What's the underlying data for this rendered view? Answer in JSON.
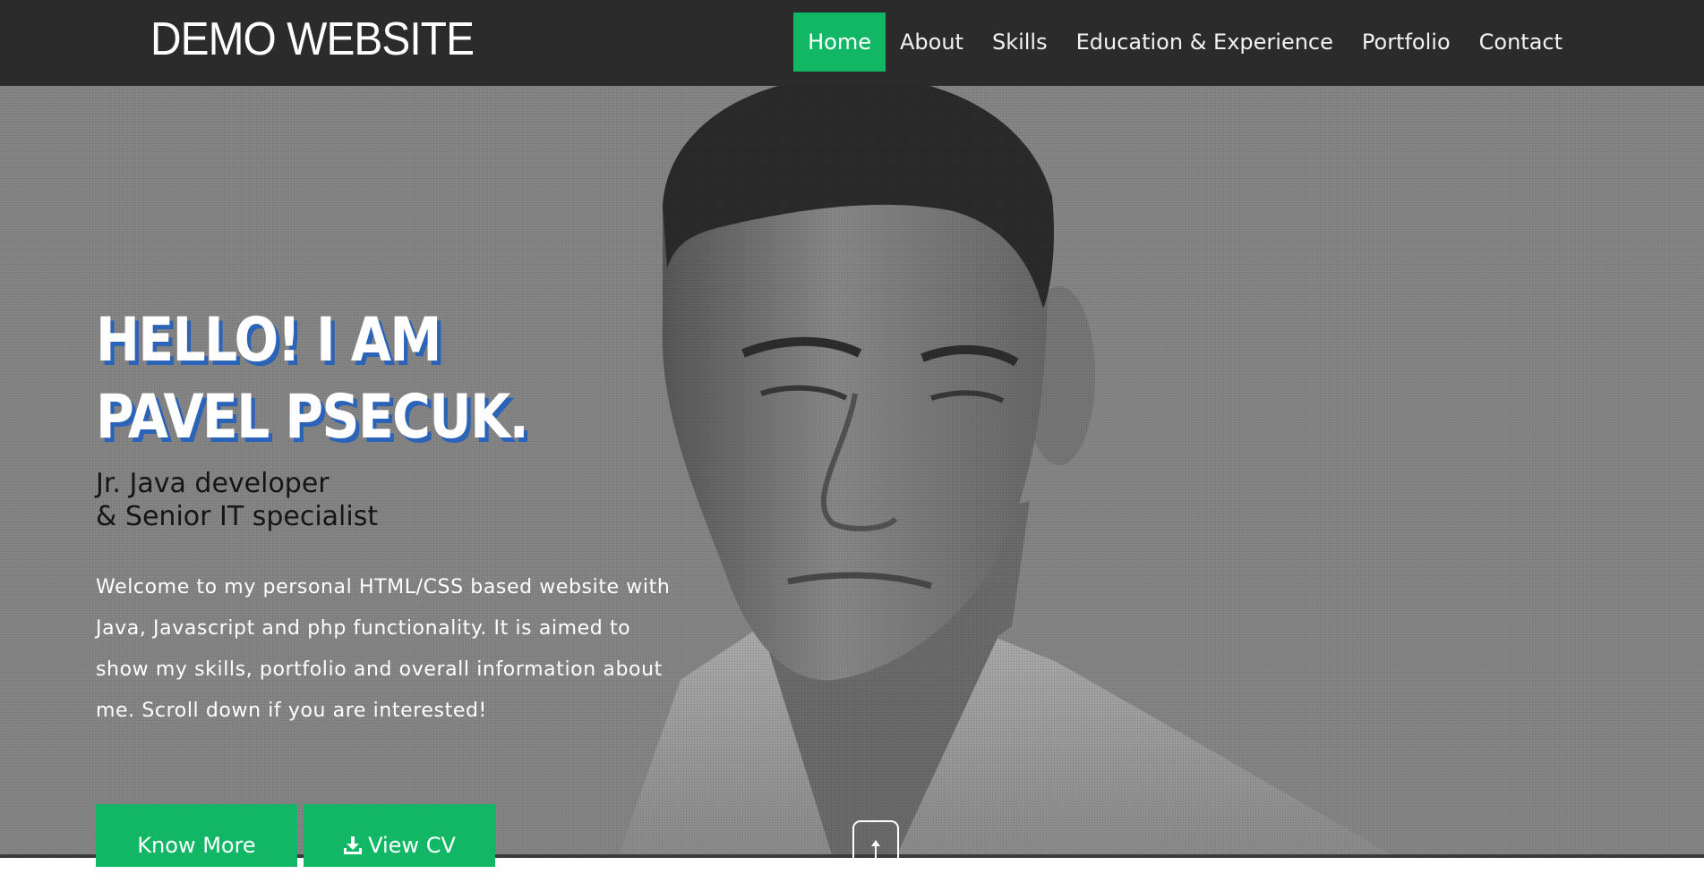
{
  "header": {
    "brand": "DEMO WEBSITE",
    "nav": [
      {
        "label": "Home",
        "active": true
      },
      {
        "label": "About",
        "active": false
      },
      {
        "label": "Skills",
        "active": false
      },
      {
        "label": "Education & Experience",
        "active": false
      },
      {
        "label": "Portfolio",
        "active": false
      },
      {
        "label": "Contact",
        "active": false
      }
    ]
  },
  "hero": {
    "headline_line1": "HELLO! I AM",
    "headline_line2": "PAVEL PSECUK.",
    "role_line1": "Jr. Java developer",
    "role_line2": "& Senior IT specialist",
    "intro": "Welcome to my personal HTML/CSS based website with Java, Javascript and php functionality. It is aimed to show my skills, portfolio and overall information about me. Scroll down if you are interested!",
    "buttons": {
      "know_more": "Know More",
      "view_cv": "View CV",
      "view_cv_icon": "download-icon"
    },
    "scroll_icon": "scroll-up-icon"
  },
  "colors": {
    "nav_bg": "#2b2b2b",
    "accent": "#12b766",
    "headline_shadow": "#2a63b8",
    "hero_bg": "#8a8a8a"
  }
}
